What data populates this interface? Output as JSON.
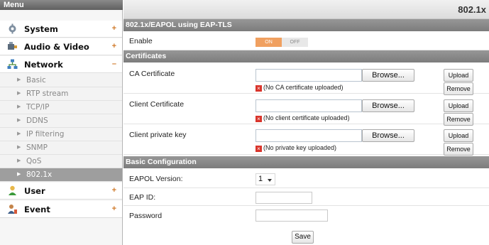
{
  "sidebar": {
    "header": "Menu",
    "sections": {
      "system": {
        "label": "System",
        "toggle": "+"
      },
      "audio_video": {
        "label": "Audio & Video",
        "toggle": "+"
      },
      "network": {
        "label": "Network",
        "toggle": "–"
      },
      "user": {
        "label": "User",
        "toggle": "+"
      },
      "event": {
        "label": "Event",
        "toggle": "+"
      }
    },
    "network_items": [
      "Basic",
      "RTP stream",
      "TCP/IP",
      "DDNS",
      "IP filtering",
      "SNMP",
      "QoS",
      "802.1x"
    ],
    "active_item": "802.1x"
  },
  "main": {
    "page_title": "802.1x",
    "sections": {
      "eap": "802.1x/EAPOL using EAP-TLS",
      "certificates": "Certificates",
      "basic": "Basic Configuration"
    },
    "enable": {
      "label": "Enable",
      "on": "ON",
      "off": "OFF",
      "state": "ON"
    },
    "certificates": [
      {
        "label": "CA Certificate",
        "browse": "Browse...",
        "upload": "Upload",
        "remove": "Remove",
        "status": "(No CA certificate uploaded)"
      },
      {
        "label": "Client Certificate",
        "browse": "Browse...",
        "upload": "Upload",
        "remove": "Remove",
        "status": "(No client certificate uploaded)"
      },
      {
        "label": "Client private key",
        "browse": "Browse...",
        "upload": "Upload",
        "remove": "Remove",
        "status": "(No private key uploaded)"
      }
    ],
    "basic": {
      "eapol_version_label": "EAPOL Version:",
      "eapol_version_value": "1",
      "eap_id_label": "EAP ID:",
      "eap_id_value": "",
      "password_label": "Password",
      "password_value": ""
    },
    "save_label": "Save"
  },
  "colors": {
    "accent": "#f0a060",
    "section_bar": "#8a8a8a",
    "active_item_bg": "#9e9e9e",
    "error_icon": "#d9342b"
  }
}
